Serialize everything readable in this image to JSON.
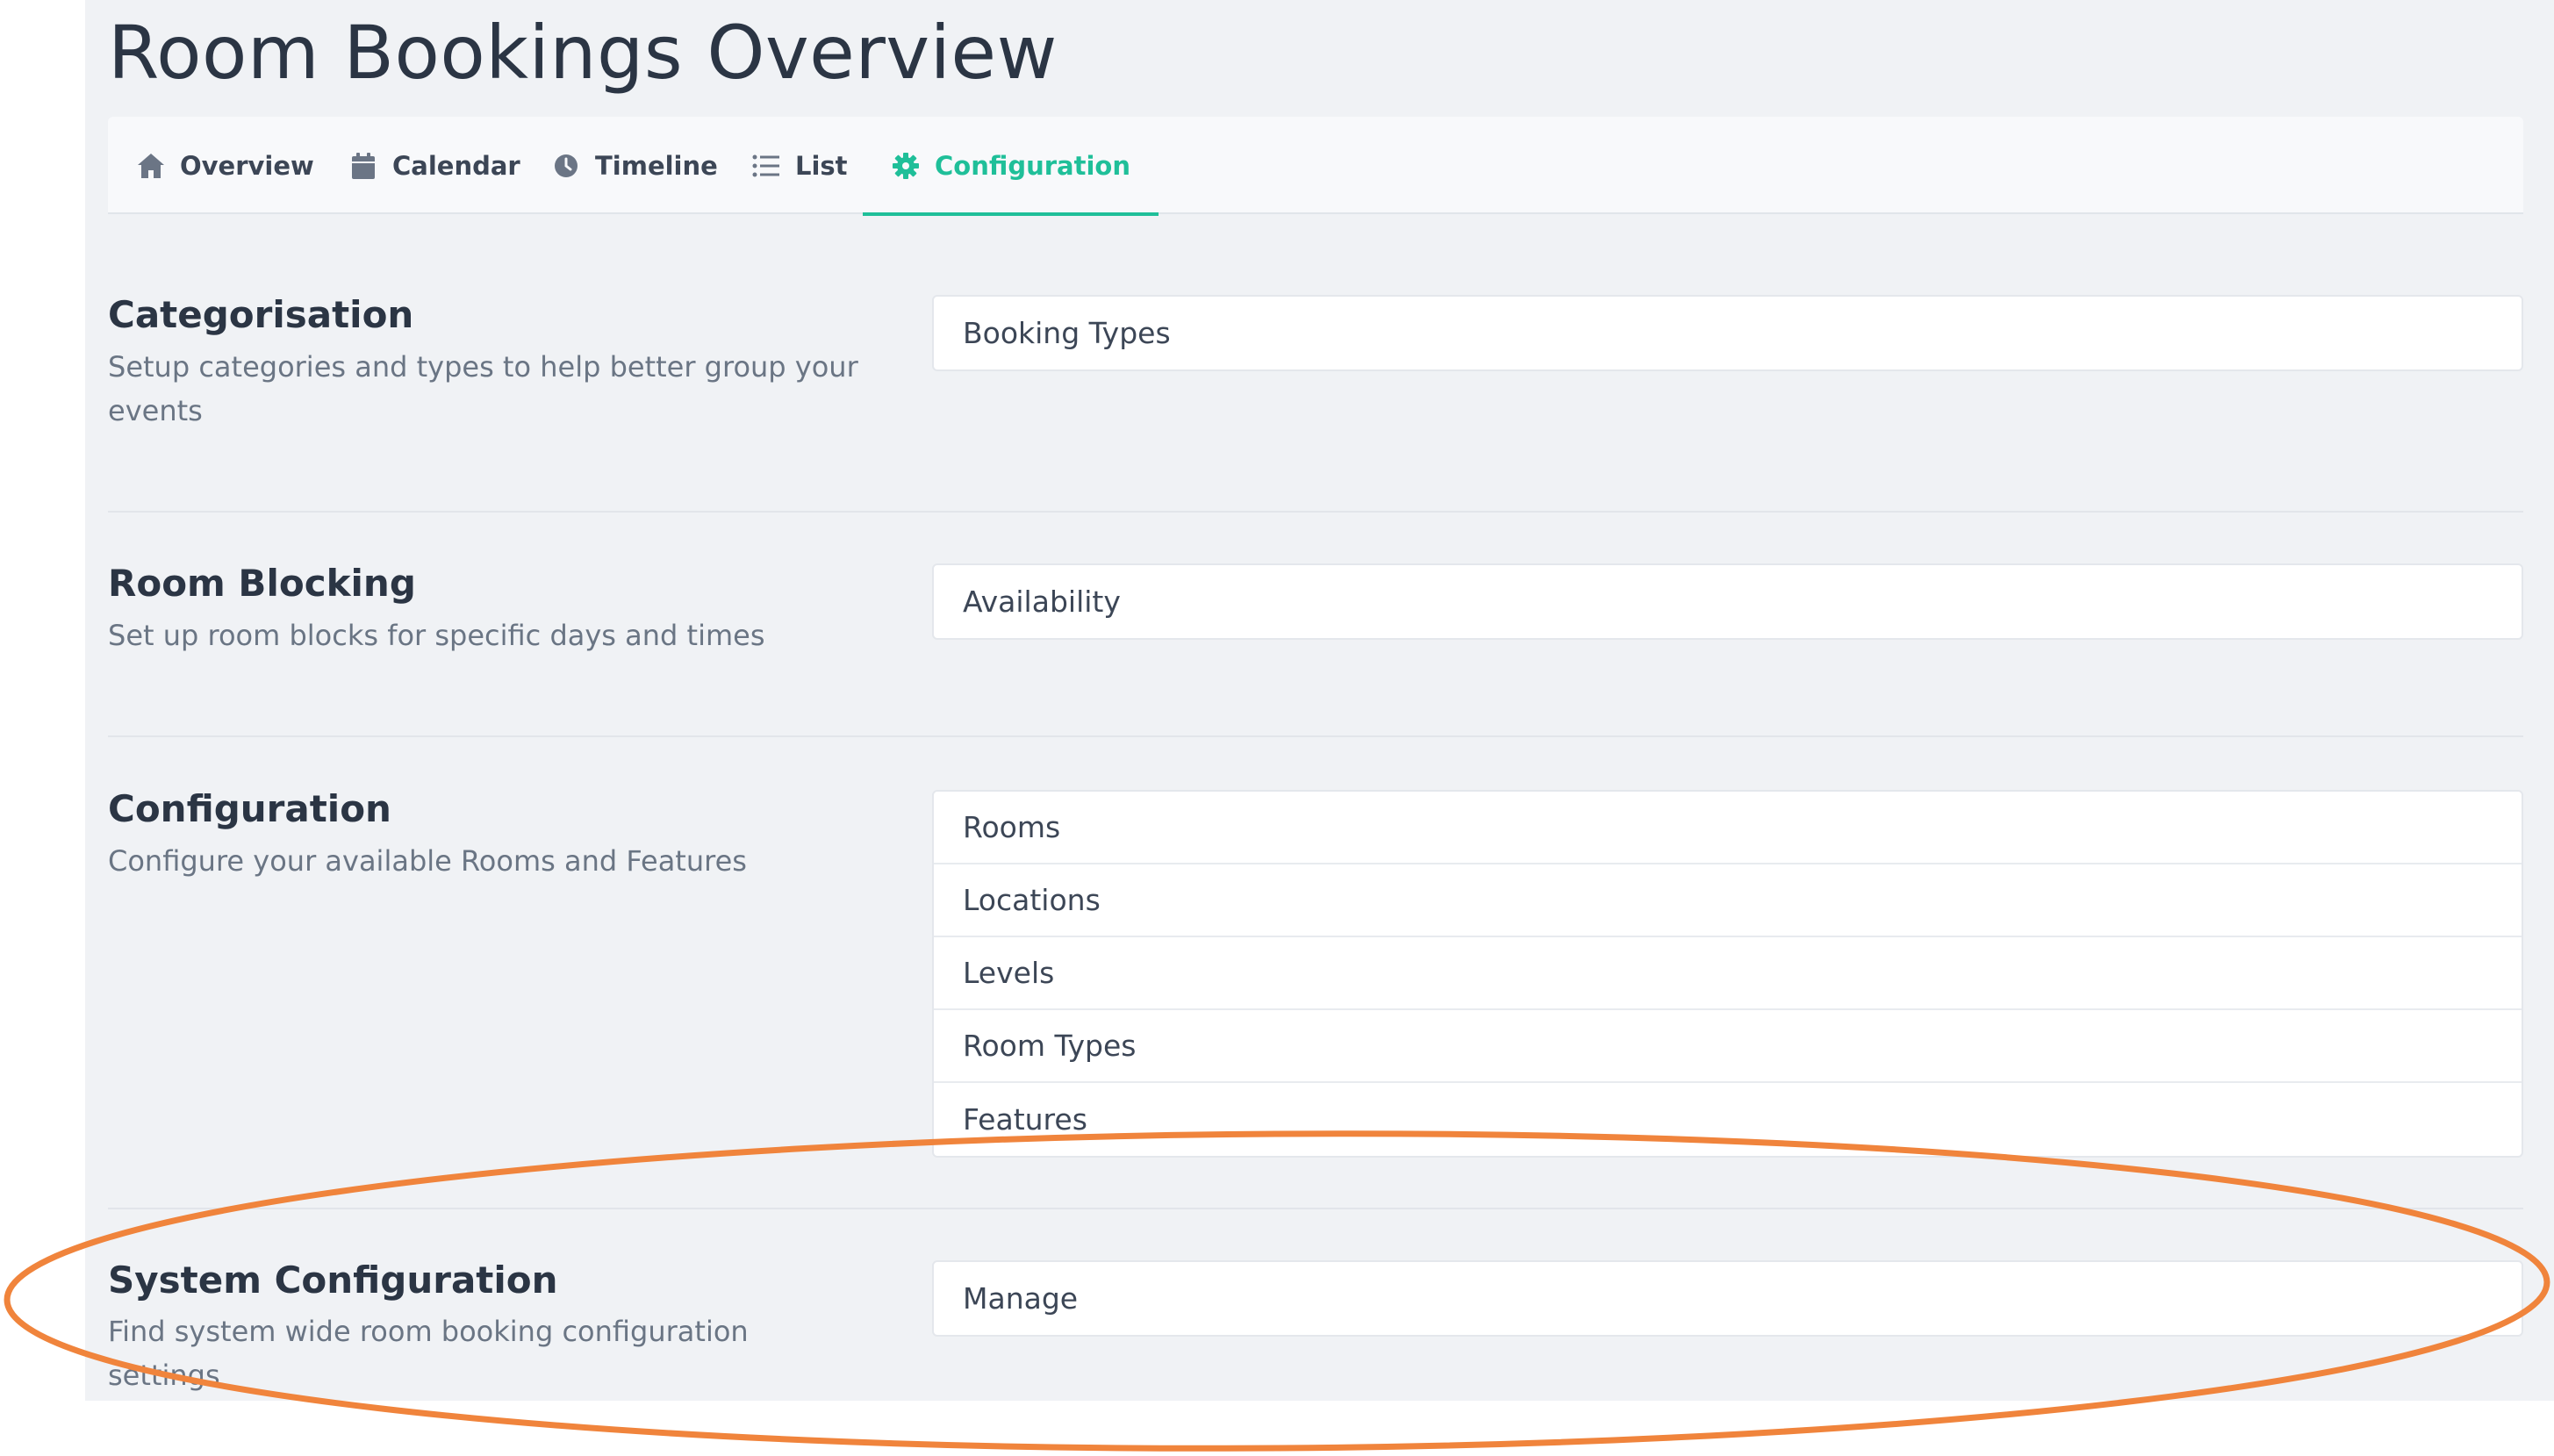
{
  "page": {
    "title": "Room Bookings Overview"
  },
  "tabs": [
    {
      "label": "Overview",
      "icon": "home-icon",
      "active": false
    },
    {
      "label": "Calendar",
      "icon": "calendar-icon",
      "active": false
    },
    {
      "label": "Timeline",
      "icon": "clock-icon",
      "active": false
    },
    {
      "label": "List",
      "icon": "list-icon",
      "active": false
    },
    {
      "label": "Configuration",
      "icon": "gear-icon",
      "active": true
    }
  ],
  "sections": [
    {
      "title": "Categorisation",
      "description": "Setup categories and types to help better group your events",
      "items": [
        "Booking Types"
      ]
    },
    {
      "title": "Room Blocking",
      "description": "Set up room blocks for specific days and times",
      "items": [
        "Availability"
      ]
    },
    {
      "title": "Configuration",
      "description": "Configure your available Rooms and Features",
      "items": [
        "Rooms",
        "Locations",
        "Levels",
        "Room Types",
        "Features"
      ]
    },
    {
      "title": "System Configuration",
      "description": "Find system wide room booking configuration settings",
      "items": [
        "Manage"
      ]
    }
  ],
  "colors": {
    "accent": "#1fbf99",
    "background": "#f0f2f5",
    "annotation": "#f0843c"
  }
}
